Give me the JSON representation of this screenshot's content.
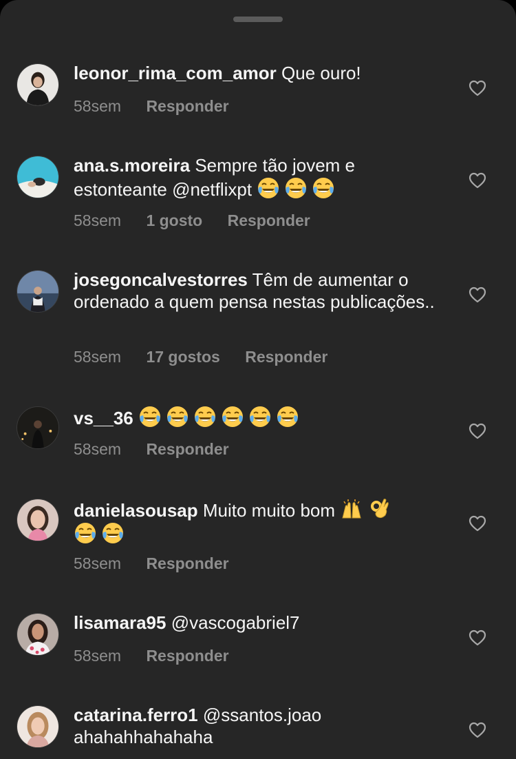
{
  "comments": [
    {
      "user": "leonor_rima_com_amor",
      "text": "Que ouro!",
      "emojis": [],
      "time": "58sem",
      "likes": "",
      "reply": "Responder",
      "avatar": "avatar-leonor"
    },
    {
      "user": "ana.s.moreira",
      "text": "Sempre tão jovem e estonteante @netflixpt",
      "emojis": [
        "laughing-crying-emoji",
        "laughing-crying-emoji",
        "laughing-crying-emoji"
      ],
      "time": "58sem",
      "likes": "1 gosto",
      "reply": "Responder",
      "avatar": "avatar-ana"
    },
    {
      "user": "josegoncalvestorres",
      "text": "Têm de aumentar o ordenado a quem pensa nestas publicações..",
      "emojis": [],
      "time": "58sem",
      "likes": "17 gostos",
      "reply": "Responder",
      "avatar": "avatar-jose"
    },
    {
      "user": "vs__36",
      "text": "",
      "emojis": [
        "laughing-crying-emoji",
        "laughing-crying-emoji",
        "laughing-crying-emoji",
        "laughing-crying-emoji",
        "laughing-crying-emoji",
        "laughing-crying-emoji"
      ],
      "time": "58sem",
      "likes": "",
      "reply": "Responder",
      "avatar": "avatar-vs"
    },
    {
      "user": "danielasousap",
      "text": "Muito muito bom",
      "emojis": [
        "raising-hands-emoji",
        "ok-hand-emoji",
        "laughing-crying-emoji",
        "laughing-crying-emoji"
      ],
      "time": "58sem",
      "likes": "",
      "reply": "Responder",
      "avatar": "avatar-daniela"
    },
    {
      "user": "lisamara95",
      "text": "@vascogabriel7",
      "emojis": [],
      "time": "58sem",
      "likes": "",
      "reply": "Responder",
      "avatar": "avatar-lisa"
    },
    {
      "user": "catarina.ferro1",
      "text": "@ssantos.joao ahahahhahahaha",
      "emojis": [],
      "time": "",
      "likes": "",
      "reply": "",
      "avatar": "avatar-catarina"
    }
  ],
  "icons": {
    "like": "heart-outline-icon"
  },
  "colors": {
    "sheet": "#262626",
    "text": "#f5f5f5",
    "meta": "#8e8e8e"
  }
}
